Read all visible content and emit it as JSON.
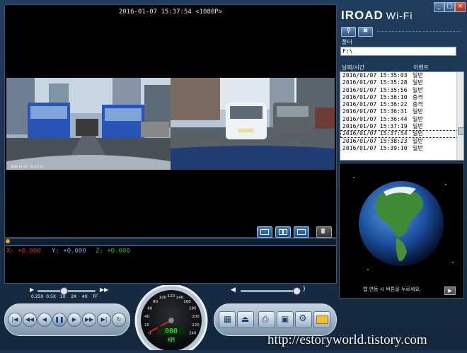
{
  "window": {
    "title_brand": "IROAD",
    "title_suffix": "Wi-Fi",
    "controls": [
      "_",
      "□",
      "×"
    ]
  },
  "video": {
    "timestamp": "2016-01-07 15:37:54 <1080P>"
  },
  "gsensor": {
    "x_label": "X: +0.000",
    "y_label": "Y: +0.000",
    "z_label": "Z: +0.000",
    "x_color": "#e03030",
    "y_color": "#7aa8ff",
    "z_color": "#30c030"
  },
  "toolbar": {
    "search_icon": "search-icon",
    "settings_icon": "tools-icon"
  },
  "folder": {
    "label": "폴더",
    "value": "F:\\"
  },
  "list": {
    "col_datetime": "날짜/시간",
    "col_event": "이벤트",
    "rows": [
      {
        "dt": "2016/01/07 15:35:03",
        "ev": "일반"
      },
      {
        "dt": "2016/01/07 15:35:28",
        "ev": "일반"
      },
      {
        "dt": "2016/01/07 15:35:56",
        "ev": "일반"
      },
      {
        "dt": "2016/01/07 15:36:10",
        "ev": "충격"
      },
      {
        "dt": "2016/01/07 15:36:22",
        "ev": "충격"
      },
      {
        "dt": "2016/01/07 15:36:31",
        "ev": "일반"
      },
      {
        "dt": "2016/01/07 15:36:44",
        "ev": "일반"
      },
      {
        "dt": "2016/01/07 15:37:19",
        "ev": "일반"
      },
      {
        "dt": "2016/01/07 15:37:54",
        "ev": "일반"
      },
      {
        "dt": "2016/01/07 15:38:23",
        "ev": "일반"
      },
      {
        "dt": "2016/01/07 15:39:10",
        "ev": "일반"
      }
    ],
    "selected_index": 8
  },
  "map": {
    "message": "맵 연동 시 버튼을 누르세요.",
    "play_label": "▶"
  },
  "speed": {
    "labels": "0.25X  0.5X   1X    2X    4X    FF"
  },
  "gauge": {
    "readout": "000",
    "unit": "KM",
    "ticks": [
      "0",
      "20",
      "40",
      "60",
      "80",
      "100",
      "120",
      "140",
      "160",
      "180",
      "200",
      "220",
      "240"
    ]
  },
  "watermark": "http://estoryworld.tistory.com"
}
